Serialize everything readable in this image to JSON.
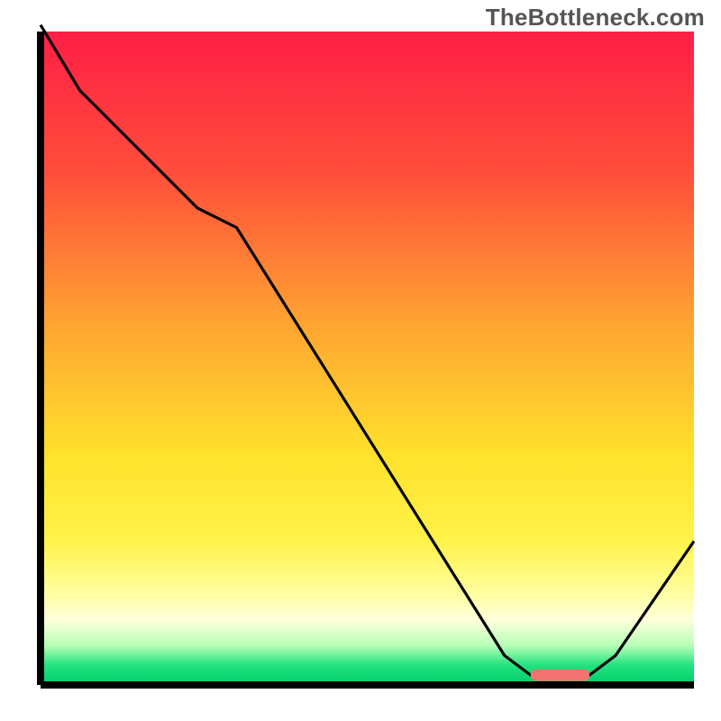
{
  "watermark": "TheBottleneck.com",
  "chart_data": {
    "type": "line",
    "title": "",
    "xlabel": "",
    "ylabel": "",
    "xlim": [
      0,
      100
    ],
    "ylim": [
      0,
      100
    ],
    "grid": false,
    "legend": false,
    "background_gradient_stops": [
      {
        "offset": 0.0,
        "color": "#ff1e46"
      },
      {
        "offset": 0.22,
        "color": "#ff4f3a"
      },
      {
        "offset": 0.45,
        "color": "#ffa531"
      },
      {
        "offset": 0.65,
        "color": "#ffe22c"
      },
      {
        "offset": 0.78,
        "color": "#fff24a"
      },
      {
        "offset": 0.86,
        "color": "#ffffa0"
      },
      {
        "offset": 0.9,
        "color": "#ffffdc"
      },
      {
        "offset": 0.94,
        "color": "#b6ffb6"
      },
      {
        "offset": 0.97,
        "color": "#22e27e"
      },
      {
        "offset": 1.0,
        "color": "#00cc6a"
      }
    ],
    "curve": {
      "x": [
        0,
        6,
        24,
        30,
        71,
        75,
        84,
        88,
        100
      ],
      "y": [
        101,
        91,
        73,
        70,
        4.5,
        1.5,
        1.5,
        4.5,
        22
      ]
    },
    "marker_bar": {
      "x_start": 75,
      "x_end": 84,
      "y": 1.5,
      "color": "#f2736f"
    }
  }
}
